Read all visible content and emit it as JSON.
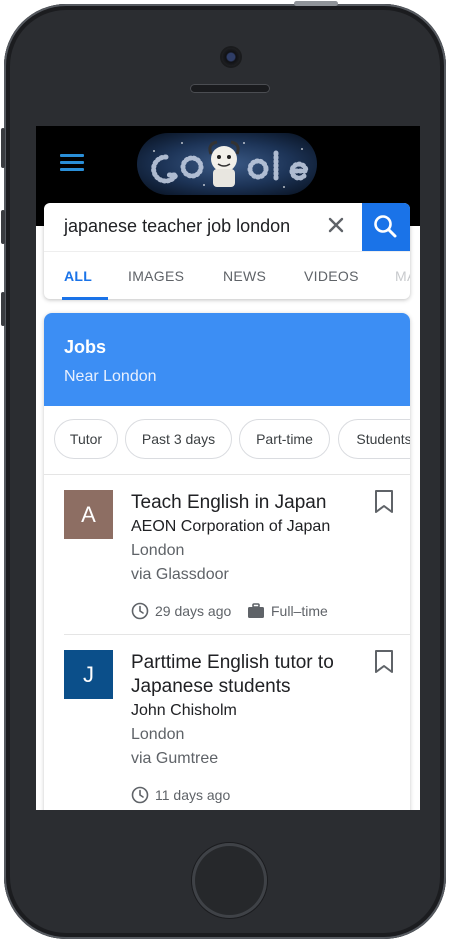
{
  "search": {
    "query": "japanese teacher job london",
    "clear_icon": "close-icon",
    "search_icon": "search-icon"
  },
  "tabs": [
    {
      "label": "ALL",
      "active": true
    },
    {
      "label": "IMAGES",
      "active": false
    },
    {
      "label": "NEWS",
      "active": false
    },
    {
      "label": "VIDEOS",
      "active": false
    },
    {
      "label": "MAPS",
      "active": false
    }
  ],
  "jobs_panel": {
    "title": "Jobs",
    "subtitle": "Near London",
    "accent": "#3c8ef4"
  },
  "filters": [
    "Tutor",
    "Past 3 days",
    "Part-time",
    "Students"
  ],
  "jobs": [
    {
      "logo_letter": "A",
      "logo_color": "#8d6e63",
      "title": "Teach English in Japan",
      "company": "AEON Corporation of Japan",
      "location": "London",
      "source": "via Glassdoor",
      "posted": "29 days ago",
      "type": "Full–time"
    },
    {
      "logo_letter": "J",
      "logo_color": "#0b4f8a",
      "title": "Parttime English tutor to Japanese students",
      "company": "John Chisholm",
      "location": "London",
      "source": "via Gumtree",
      "posted": "11 days ago"
    }
  ],
  "colors": {
    "brand_blue": "#1a73e8",
    "topbar": "#000000",
    "phone_body": "#2b2d31"
  }
}
